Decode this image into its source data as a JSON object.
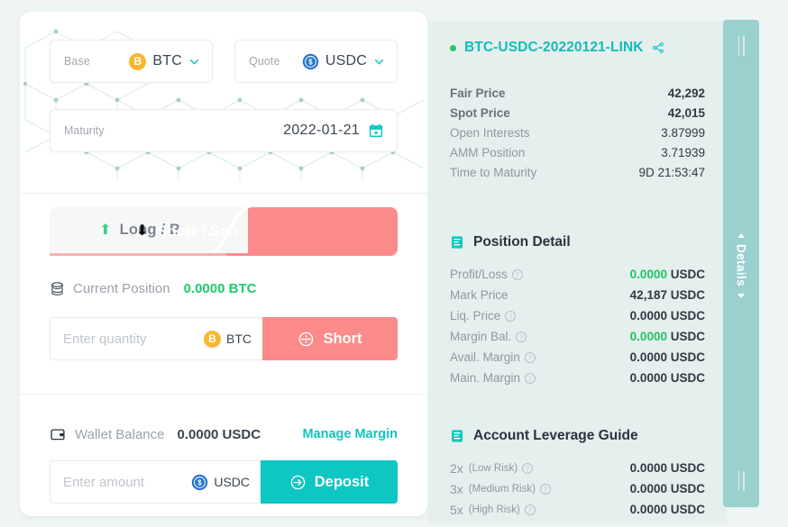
{
  "trade": {
    "base": {
      "label": "Base",
      "value": "BTC",
      "icon": "bitcoin-coin-icon"
    },
    "quote": {
      "label": "Quote",
      "value": "USDC",
      "icon": "usdc-coin-icon"
    },
    "maturity": {
      "label": "Maturity",
      "value": "2022-01-21",
      "icon": "calendar-icon"
    },
    "tabs": {
      "long": {
        "label": "Long / Buy",
        "icon": "arrow-up-icon",
        "active": false
      },
      "short": {
        "label": "Short / Sell",
        "icon": "arrow-down-icon",
        "active": true
      }
    },
    "position": {
      "label": "Current Position",
      "value": "0.0000 BTC",
      "icon": "coins-stack-icon"
    },
    "quantity": {
      "placeholder": "Enter quantity",
      "value": "",
      "unit": "BTC"
    },
    "short_button": {
      "label": "Short",
      "icon": "short-circle-icon"
    },
    "wallet": {
      "label": "Wallet Balance",
      "value": "0.0000 USDC",
      "icon": "wallet-icon",
      "manage_link": "Manage Margin"
    },
    "amount": {
      "placeholder": "Enter amount",
      "value": "",
      "unit": "USDC"
    },
    "deposit_button": {
      "label": "Deposit",
      "icon": "arrow-right-circle-icon"
    }
  },
  "details": {
    "title": "BTC-USDC-20220121-LINK",
    "share_icon": "share-icon",
    "status_dot": "live-status-dot",
    "stats": [
      {
        "key": "Fair Price",
        "value": "42,292",
        "strong": true
      },
      {
        "key": "Spot Price",
        "value": "42,015",
        "strong": true
      },
      {
        "key": "Open Interests",
        "value": "3.87999",
        "strong": false
      },
      {
        "key": "AMM Position",
        "value": "3.71939",
        "strong": false
      },
      {
        "key": "Time to Maturity",
        "value": "9D 21:53:47",
        "strong": false
      }
    ],
    "position_detail": {
      "heading": "Position Detail",
      "icon": "document-list-icon",
      "rows": [
        {
          "key": "Profit/Loss",
          "info": true,
          "amount": "0.0000",
          "currency": "USDC",
          "green": true
        },
        {
          "key": "Mark Price",
          "info": false,
          "amount": "42,187",
          "currency": "USDC",
          "green": false
        },
        {
          "key": "Liq. Price",
          "info": true,
          "amount": "0.0000",
          "currency": "USDC",
          "green": false
        },
        {
          "key": "Margin Bal.",
          "info": true,
          "amount": "0.0000",
          "currency": "USDC",
          "green": true
        },
        {
          "key": "Avail. Margin",
          "info": true,
          "amount": "0.0000",
          "currency": "USDC",
          "green": false
        },
        {
          "key": "Main. Margin",
          "info": true,
          "amount": "0.0000",
          "currency": "USDC",
          "green": false
        }
      ]
    },
    "leverage_guide": {
      "heading": "Account Leverage Guide",
      "icon": "document-list-icon",
      "rows": [
        {
          "mult": "2x",
          "risk": "(Low Risk)",
          "info": true,
          "amount": "0.0000",
          "currency": "USDC"
        },
        {
          "mult": "3x",
          "risk": "(Medium Risk)",
          "info": true,
          "amount": "0.0000",
          "currency": "USDC"
        },
        {
          "mult": "5x",
          "risk": "(High Risk)",
          "info": true,
          "amount": "0.0000",
          "currency": "USDC"
        }
      ]
    }
  },
  "edge_handle": {
    "label": "Details",
    "icon_up": "triangle-up-icon",
    "icon_down": "triangle-down-icon"
  },
  "colors": {
    "accent_teal": "#0ec6c2",
    "accent_pink": "#fb8b8b",
    "green": "#20c463",
    "panel_bg": "#e5efed",
    "page_bg": "#eef5f4",
    "handle": "#9ad0ce"
  }
}
